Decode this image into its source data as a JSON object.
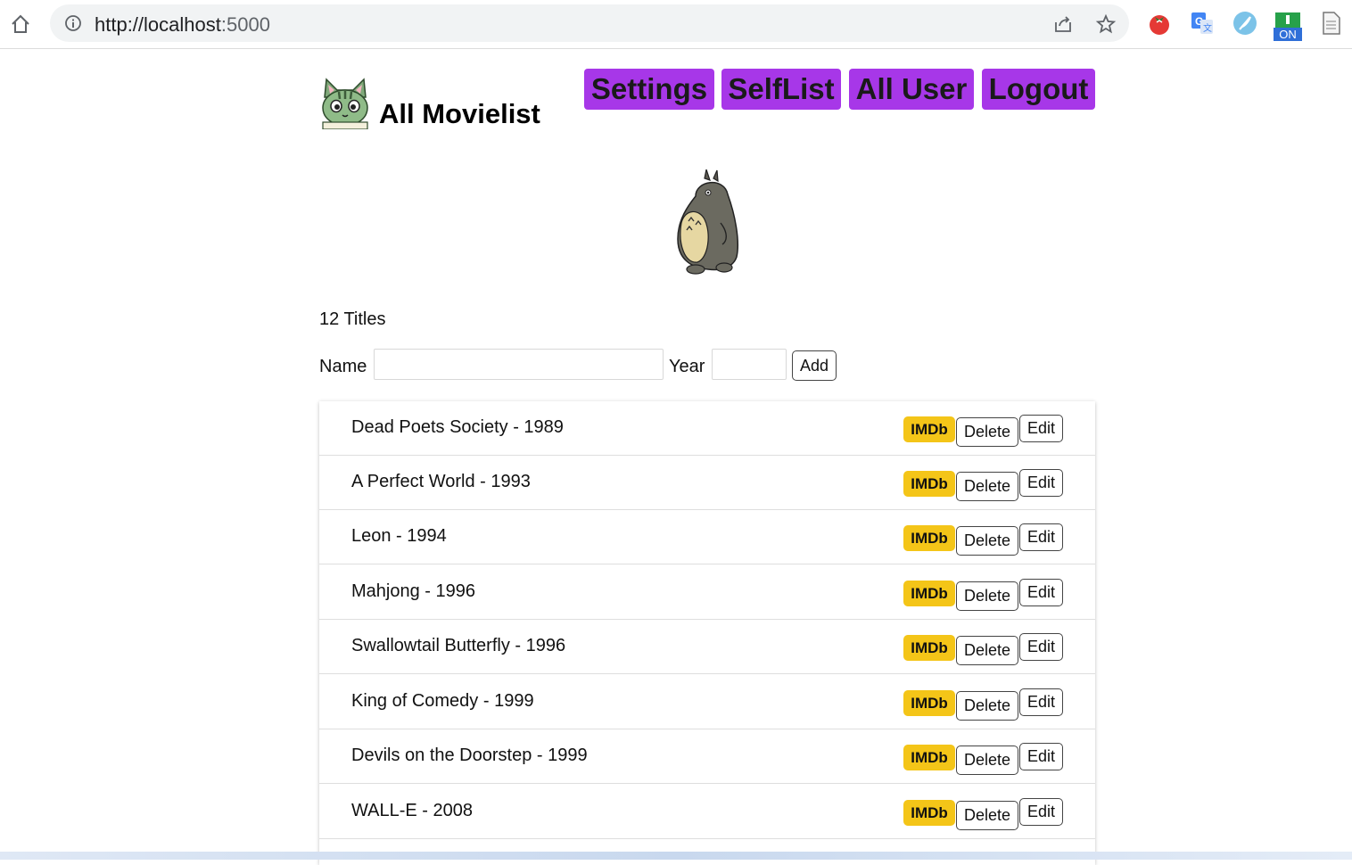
{
  "browser": {
    "url_host": "http://localhost",
    "url_port": ":5000",
    "extensions": [
      "tomato-icon",
      "translate-icon",
      "feather-icon",
      "on-switch-icon",
      "document-icon"
    ],
    "extension_badge": "ON"
  },
  "header": {
    "title": "All Movielist",
    "nav": [
      "Settings",
      "SelfList",
      "All User",
      "Logout"
    ],
    "nav_color": "#a737e8"
  },
  "summary": {
    "count_text": "12 Titles"
  },
  "add_form": {
    "name_label": "Name",
    "name_value": "",
    "year_label": "Year",
    "year_value": "",
    "add_label": "Add"
  },
  "movies": [
    {
      "title": "Dead Poets Society - 1989",
      "imdb": "IMDb",
      "delete": "Delete",
      "edit": "Edit"
    },
    {
      "title": "A Perfect World - 1993",
      "imdb": "IMDb",
      "delete": "Delete",
      "edit": "Edit"
    },
    {
      "title": "Leon - 1994",
      "imdb": "IMDb",
      "delete": "Delete",
      "edit": "Edit"
    },
    {
      "title": "Mahjong - 1996",
      "imdb": "IMDb",
      "delete": "Delete",
      "edit": "Edit"
    },
    {
      "title": "Swallowtail Butterfly - 1996",
      "imdb": "IMDb",
      "delete": "Delete",
      "edit": "Edit"
    },
    {
      "title": "King of Comedy - 1999",
      "imdb": "IMDb",
      "delete": "Delete",
      "edit": "Edit"
    },
    {
      "title": "Devils on the Doorstep - 1999",
      "imdb": "IMDb",
      "delete": "Delete",
      "edit": "Edit"
    },
    {
      "title": "WALL-E - 2008",
      "imdb": "IMDb",
      "delete": "Delete",
      "edit": "Edit"
    }
  ],
  "colors": {
    "imdb": "#f4c518",
    "nav": "#a737e8"
  }
}
